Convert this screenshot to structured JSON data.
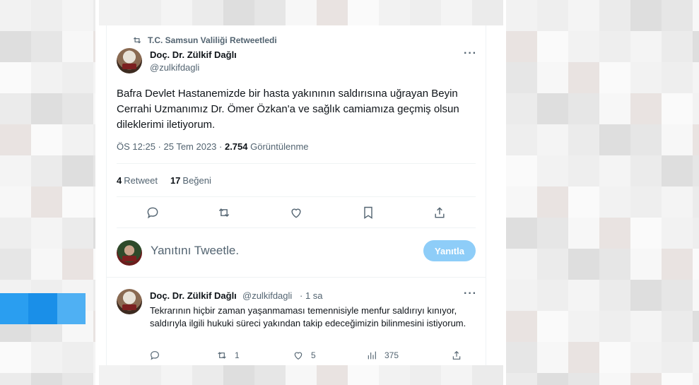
{
  "retweet_banner": {
    "text": "T.C. Samsun Valiliği Retweetledi"
  },
  "tweet": {
    "author_name": "Doç. Dr. Zülkif Dağlı",
    "author_handle": "@zulkifdagli",
    "more_label": "···",
    "text": "Bafra Devlet Hastanemizde bir hasta yakınının saldırısına uğrayan Beyin Cerrahi Uzmanımız Dr. Ömer Özkan'a ve sağlık camiamıza geçmiş olsun dileklerimi iletiyorum.",
    "time": "ÖS 12:25 · 25 Tem 2023 · ",
    "views_count": "2.754",
    "views_label": " Görüntülenme",
    "retweet_count": "4",
    "retweet_label": "Retweet",
    "like_count": "17",
    "like_label": "Beğeni"
  },
  "reply_box": {
    "placeholder": "Yanıtını Tweetle.",
    "button_label": "Yanıtla"
  },
  "reply_tweet": {
    "author_name": "Doç. Dr. Zülkif Dağlı",
    "author_handle": "@zulkifdagli",
    "time": "· 1 sa",
    "more_label": "···",
    "text": "Tekrarının hiçbir zaman yaşanmaması temennisiyle menfur saldırıyı kınıyor, saldırıyla ilgili hukuki süreci yakından takip edeceğimizin bilinmesini istiyorum.",
    "retweets": "1",
    "likes": "5",
    "views": "375"
  },
  "icons": [
    "retweet-icon",
    "reply-icon",
    "like-icon",
    "bookmark-icon",
    "share-icon",
    "views-icon",
    "more-icon"
  ],
  "colors": {
    "accent": "#1d9bf0",
    "reply_button": "#8ecdf8",
    "secondary_text": "#536471"
  }
}
